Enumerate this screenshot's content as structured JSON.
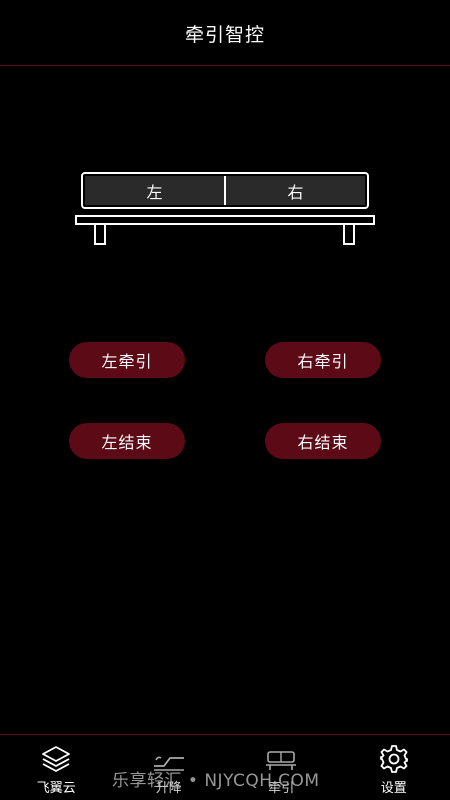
{
  "header": {
    "title": "牵引智控"
  },
  "bed": {
    "left_zone": "左",
    "right_zone": "右"
  },
  "actions": {
    "left_traction": "左牵引",
    "right_traction": "右牵引",
    "left_end": "左结束",
    "right_end": "右结束"
  },
  "nav": {
    "items": [
      {
        "label": "飞翼云",
        "icon": "layers-icon"
      },
      {
        "label": "升降",
        "icon": "adjustable-bed-icon"
      },
      {
        "label": "牵引",
        "icon": "traction-bed-icon"
      },
      {
        "label": "设置",
        "icon": "gear-icon"
      }
    ]
  },
  "watermark": "乐享轻汇 • NJYCQH.COM",
  "colors": {
    "background": "#000000",
    "accent": "#5c0a16",
    "divider": "#5a1420"
  }
}
